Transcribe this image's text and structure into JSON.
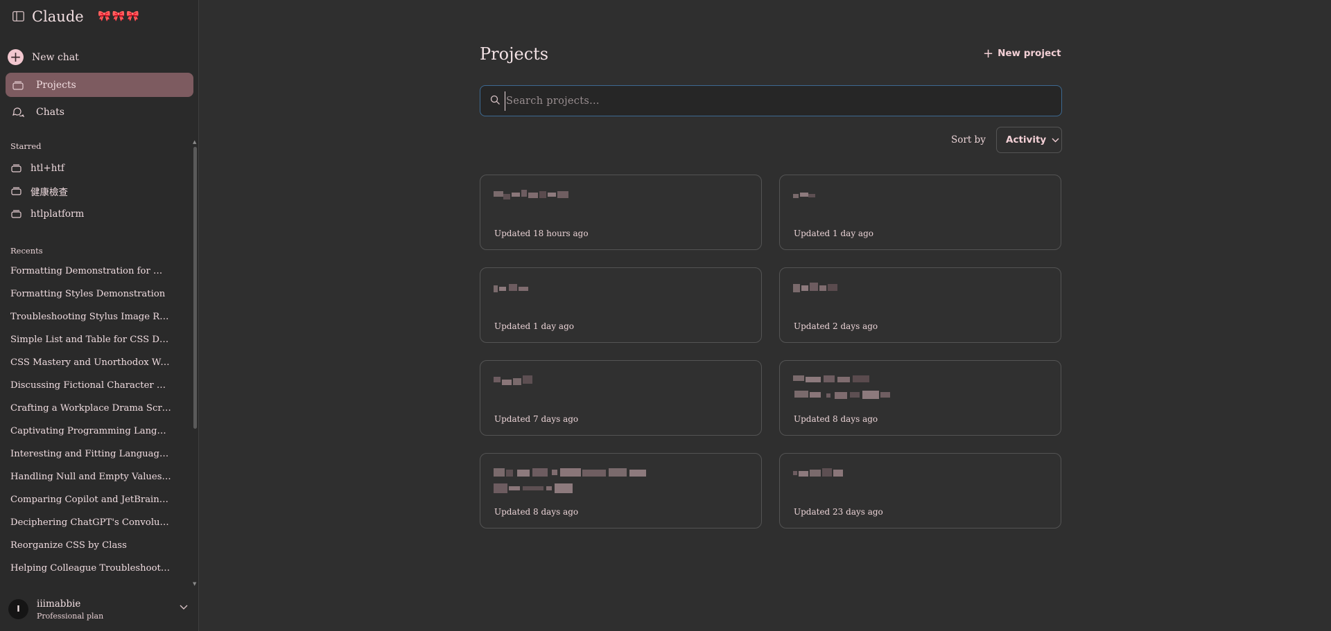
{
  "app": {
    "name": "Claude",
    "bows": "🎀🎀🎀"
  },
  "sidebar": {
    "new_chat": "New chat",
    "projects": "Projects",
    "chats": "Chats",
    "starred_label": "Starred",
    "starred": [
      {
        "label": "htl+htf"
      },
      {
        "label": "健康檢查"
      },
      {
        "label": "htlplatform"
      }
    ],
    "recents_label": "Recents",
    "recents": [
      "Formatting Demonstration for Mom",
      "Formatting Styles Demonstration",
      "Troubleshooting Stylus Image Re…",
      "Simple List and Table for CSS Demo",
      "CSS Mastery and Unorthodox Web…",
      "Discussing Fictional Character T…",
      "Crafting a Workplace Drama Script",
      "Captivating Programming Langua…",
      "Interesting and Fitting Languag…",
      "Handling Null and Empty Values …",
      "Comparing Copilot and JetBrains AI",
      "Deciphering ChatGPT's Convolute…",
      "Reorganize CSS by Class",
      "Helping Colleague Troubleshoot C…"
    ],
    "user": {
      "initial": "I",
      "name": "iiimabbie",
      "plan": "Professional plan"
    }
  },
  "main": {
    "title": "Projects",
    "new_project": "New project",
    "search_placeholder": "Search projects...",
    "sort_label": "Sort by",
    "sort_value": "Activity",
    "projects": [
      {
        "updated": "Updated 18 hours ago"
      },
      {
        "updated": "Updated 1 day ago"
      },
      {
        "updated": "Updated 1 day ago"
      },
      {
        "updated": "Updated 2 days ago"
      },
      {
        "updated": "Updated 7 days ago"
      },
      {
        "updated": "Updated 8 days ago"
      },
      {
        "updated": "Updated 8 days ago"
      },
      {
        "updated": "Updated 23 days ago"
      }
    ]
  },
  "colors": {
    "background": "#2f2f2f",
    "sidebar": "#2a2a2a",
    "active_nav": "#7d5b60",
    "accent_pink": "#f2c7cf",
    "search_border": "#3d6a92"
  }
}
